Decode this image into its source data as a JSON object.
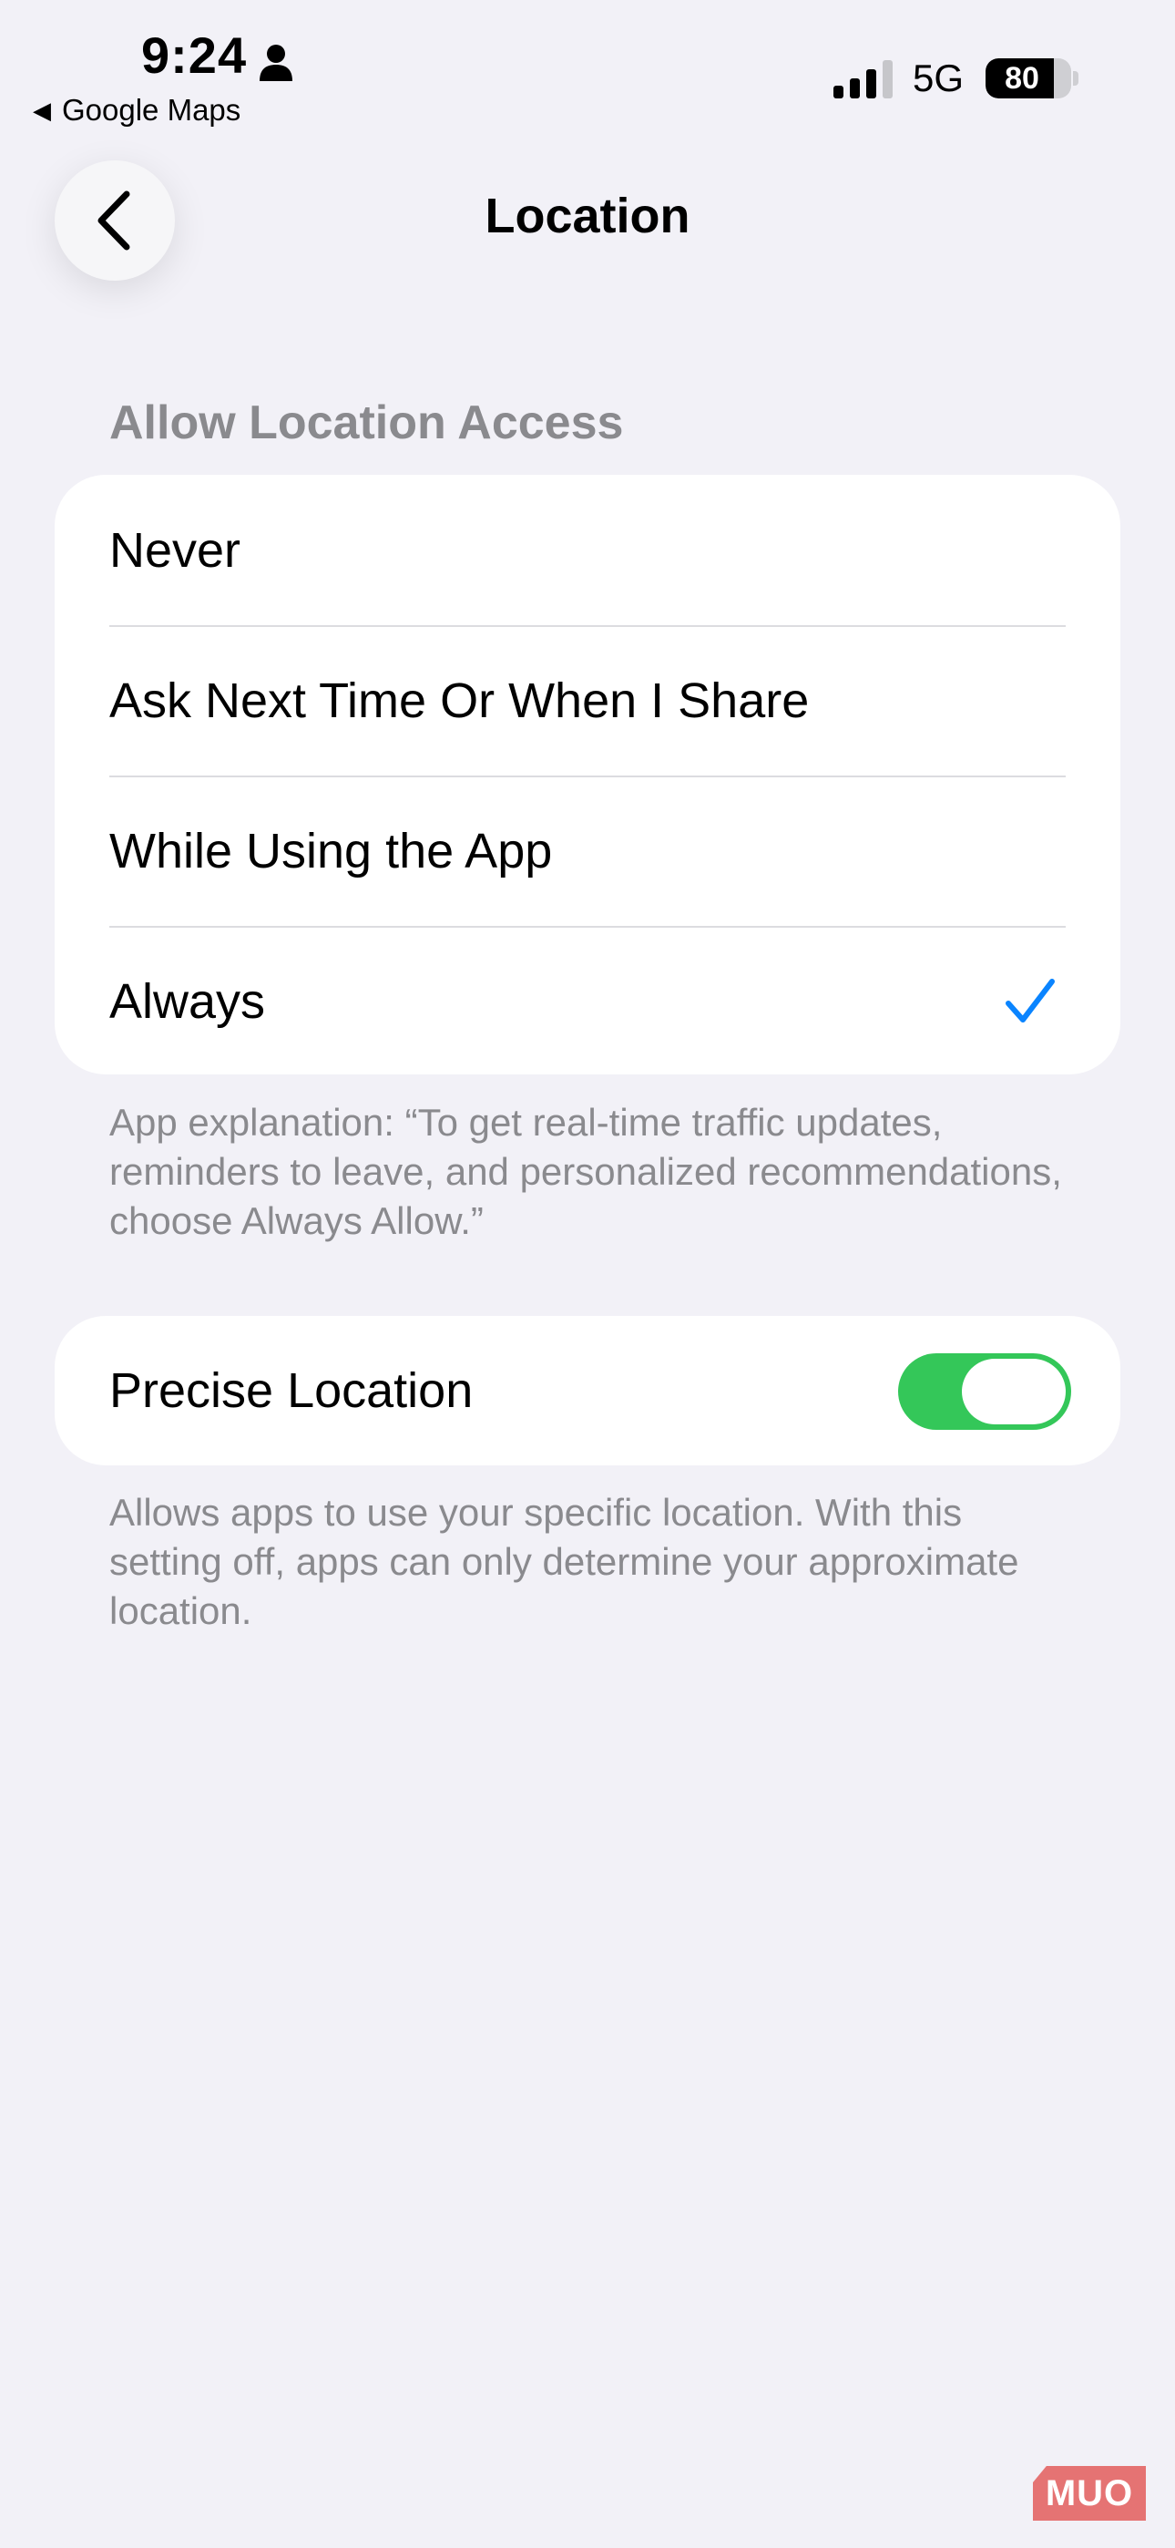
{
  "status_bar": {
    "time": "9:24",
    "back_app_label": "Google Maps",
    "network": "5G",
    "battery_level": "80",
    "battery_fraction": 0.8,
    "signal_bars_active": 3,
    "signal_bars_total": 4
  },
  "nav": {
    "title": "Location",
    "back_icon": "chevron-left-icon"
  },
  "allow_section": {
    "header": "Allow Location Access",
    "options": [
      {
        "label": "Never",
        "selected": false
      },
      {
        "label": "Ask Next Time Or When I Share",
        "selected": false
      },
      {
        "label": "While Using the App",
        "selected": false
      },
      {
        "label": "Always",
        "selected": true
      }
    ],
    "footer": "App explanation: “To get real-time traffic updates, reminders to leave, and personalized recommendations, choose Always Allow.”"
  },
  "precise_section": {
    "label": "Precise Location",
    "toggle_on": true,
    "footer": "Allows apps to use your specific location. With this setting off, apps can only determine your approximate location."
  },
  "watermark": "MUO",
  "colors": {
    "background": "#f2f1f7",
    "card": "#ffffff",
    "accent": "#0a84ff",
    "toggle_on": "#34c759",
    "secondary_text": "#8a8a8e"
  }
}
